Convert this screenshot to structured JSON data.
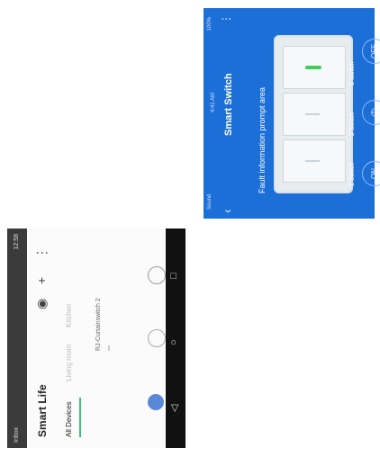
{
  "left_screen": {
    "status_left": "Inbox",
    "status_right": "12:58",
    "app_title": "Smart Life",
    "tabs": [
      "All Devices",
      "Living room",
      "Kitchen"
    ],
    "device_name": "RJ-Curtainswitch 2",
    "icons": [
      "plus-icon",
      "add-scene-icon",
      "more-icon"
    ],
    "nav_icons": [
      "home-icon",
      "scene-icon",
      "profile-icon"
    ],
    "sys_buttons": [
      "◁",
      "○",
      "□"
    ]
  },
  "right_screen": {
    "status_left": "Sound",
    "status_right": "100%",
    "time": "4:41 AM",
    "title": "Smart Switch",
    "fault_text": "Fault information prompt area",
    "switch_labels": [
      "1 Switch",
      "2 Switch",
      "3 Switch"
    ],
    "buttons": {
      "on": "ON",
      "off": "OFF"
    },
    "colors": {
      "bg": "#1d6fd8",
      "led": "#3ecf5a"
    }
  }
}
